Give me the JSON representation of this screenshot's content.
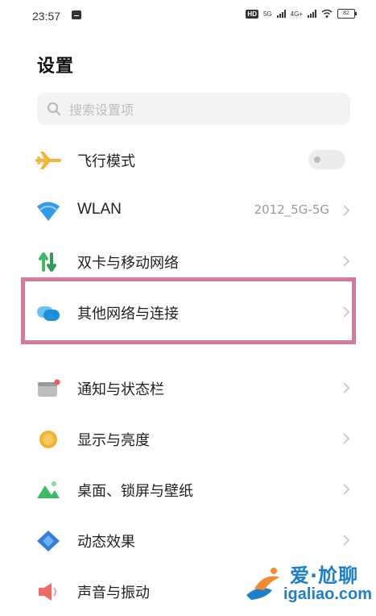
{
  "status_bar": {
    "time": "23:57",
    "hd_badge": "HD",
    "net1": "5G",
    "net2": "4G+",
    "battery": "82"
  },
  "page": {
    "title": "设置"
  },
  "search": {
    "placeholder": "搜索设置项"
  },
  "items": [
    {
      "label": "飞行模式",
      "icon": "airplane-icon",
      "color": "#f3b63b"
    },
    {
      "label": "WLAN",
      "value": "2012_5G-5G",
      "icon": "wifi-icon",
      "color": "#2f9bea"
    },
    {
      "label": "双卡与移动网络",
      "icon": "dual-sim-icon",
      "color": "#3cba67"
    },
    {
      "label": "其他网络与连接",
      "icon": "connections-icon",
      "color": "#2aa4e6"
    },
    {
      "label": "通知与状态栏",
      "icon": "notification-icon",
      "color": "#9a9a9a"
    },
    {
      "label": "显示与亮度",
      "icon": "brightness-icon",
      "color": "#f4b12f"
    },
    {
      "label": "桌面、锁屏与壁纸",
      "icon": "wallpaper-icon",
      "color": "#3cba67"
    },
    {
      "label": "动态效果",
      "icon": "dynamic-effect-icon",
      "color": "#2f7fe0"
    },
    {
      "label": "声音与振动",
      "icon": "sound-icon",
      "color": "#ef6b64"
    }
  ],
  "airplane_mode_on": false,
  "highlight_color": "#d57a9d",
  "watermark": {
    "main": "爱·尬聊",
    "sub": "igaliao.com"
  }
}
